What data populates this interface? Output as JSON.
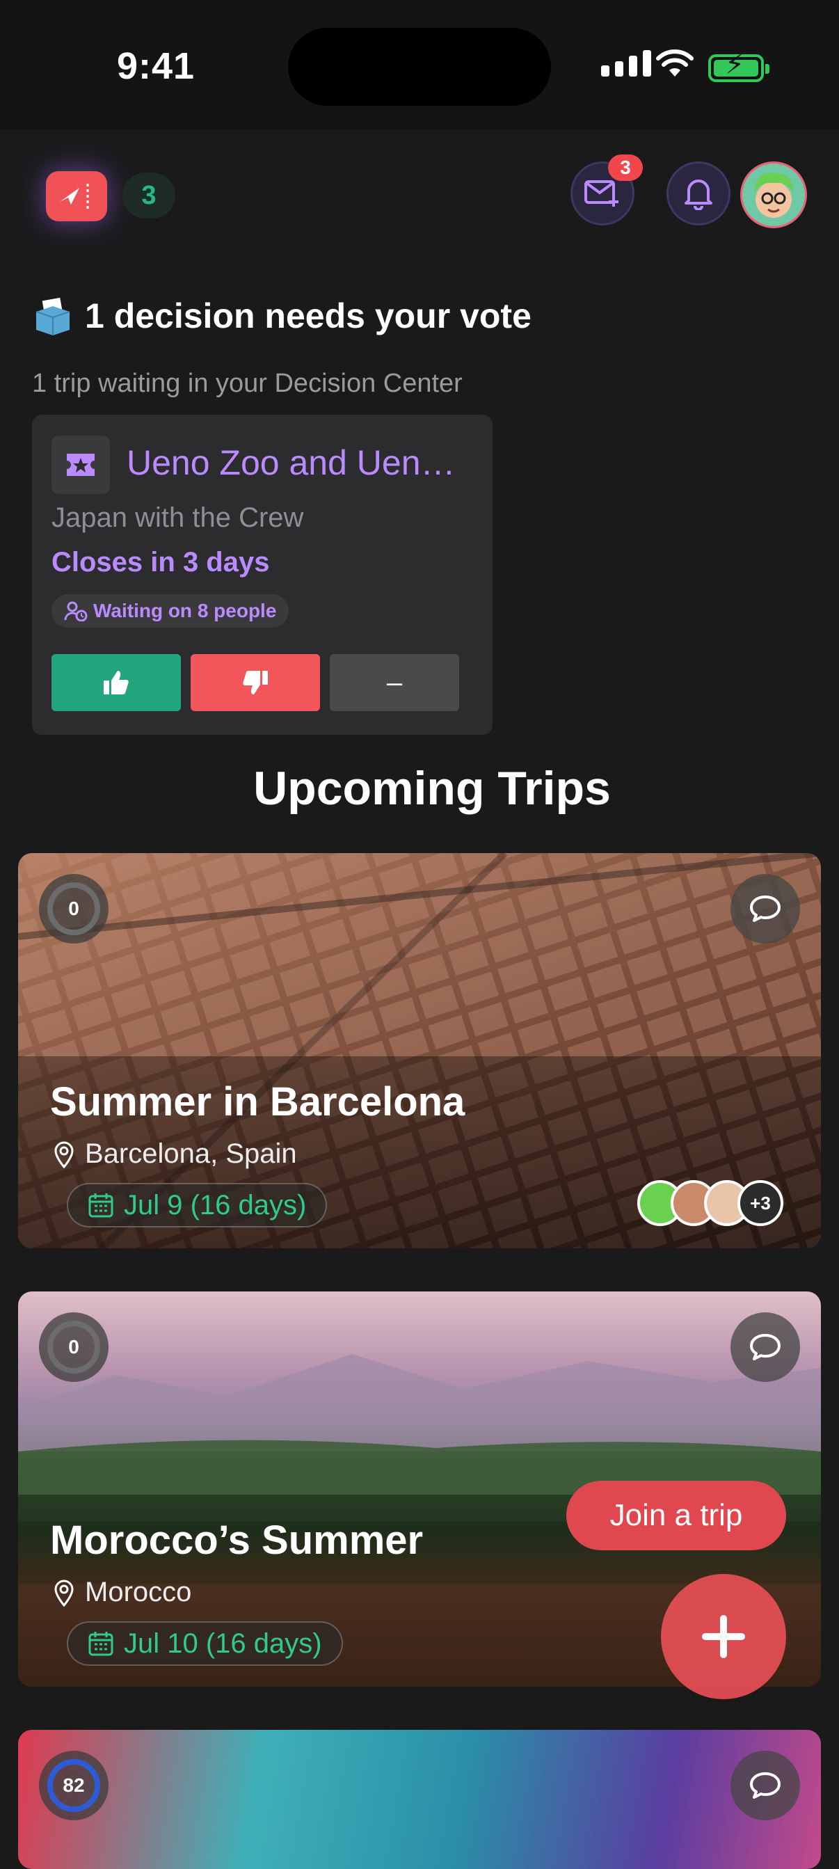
{
  "status_bar": {
    "time": "9:41"
  },
  "header": {
    "ticket_count": "3",
    "inbox_badge": "3"
  },
  "decision": {
    "title": "1 decision needs your vote",
    "subtitle": "1 trip waiting in your Decision Center",
    "card": {
      "name": "Ueno Zoo and Uen…",
      "trip": "Japan with the Crew",
      "closes": "Closes in 3 days",
      "waiting": "Waiting on 8 people",
      "abstain_label": "–"
    }
  },
  "section_title": "Upcoming Trips",
  "trips": [
    {
      "progress": "0",
      "name": "Summer in Barcelona",
      "location": "Barcelona, Spain",
      "date": "Jul 9 (16 days)",
      "extra_members": "+3"
    },
    {
      "progress": "0",
      "name": "Morocco’s Summer",
      "location": "Morocco",
      "date": "Jul 10 (16 days)"
    },
    {
      "progress": "82"
    }
  ],
  "join_button": "Join a trip",
  "colors": {
    "accent_purple": "#b98bff",
    "green": "#22b88a",
    "red": "#f05258"
  }
}
